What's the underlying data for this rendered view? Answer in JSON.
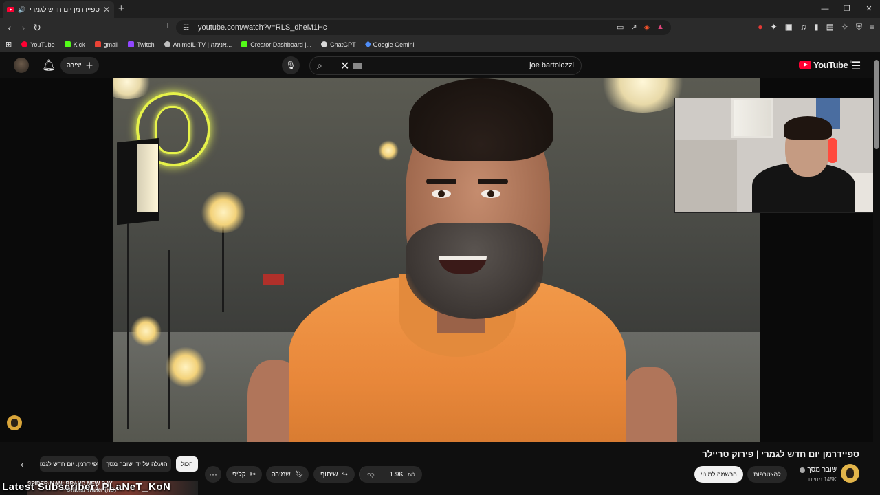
{
  "browser": {
    "tab_title": "ספיידרמן יום חדש לגמרי | פירו...",
    "url": "youtube.com/watch?v=RLS_dheM1Hc",
    "bookmarks": [
      {
        "label": "YouTube",
        "color": "#ff0033"
      },
      {
        "label": "Kick",
        "color": "#53fc18"
      },
      {
        "label": "gmail",
        "color": "#ea4335"
      },
      {
        "label": "Twitch",
        "color": "#9146ff"
      },
      {
        "label": "AnimeIL-TV | אנימה...",
        "color": "#c0c0c0"
      },
      {
        "label": "Creator Dashboard |...",
        "color": "#53fc18"
      },
      {
        "label": "ChatGPT",
        "color": "#d9d9d9"
      },
      {
        "label": "Google Gemini",
        "color": "#4f8df7"
      }
    ]
  },
  "youtube": {
    "create_label": "יצירה",
    "search_query": "joe bartolozzi",
    "logo_text": "YouTube",
    "logo_region": "IL"
  },
  "video": {
    "title": "ספיידרמן יום חדש לגמרי | פירוק טריילר",
    "channel_name": "שובר מסך",
    "subscribers": "145K מנויים",
    "join_label": "להצטרפות",
    "subscribe_label": "הרשמה למינוי",
    "likes": "1.9K",
    "share_label": "שיתוף",
    "save_label": "שמירה",
    "clip_label": "קליפ",
    "more_label": "···"
  },
  "chips": {
    "all": "הכול",
    "uploaded_by": "הועלה על ידי שובר מסך",
    "related": "ספיידרמן: יום חדש לגמרי"
  },
  "overlay": {
    "latest_subscriber": "Latest Subscriber: PLaNeT_KoN",
    "ticker_title": "SPIDER-MAN: BRAND NEW DAY",
    "ticker_subtitle": "– Official Trailer (HD)"
  },
  "colors": {
    "yt_red": "#ff0033",
    "background": "#0f0f0f",
    "chip_bg": "#272727"
  }
}
